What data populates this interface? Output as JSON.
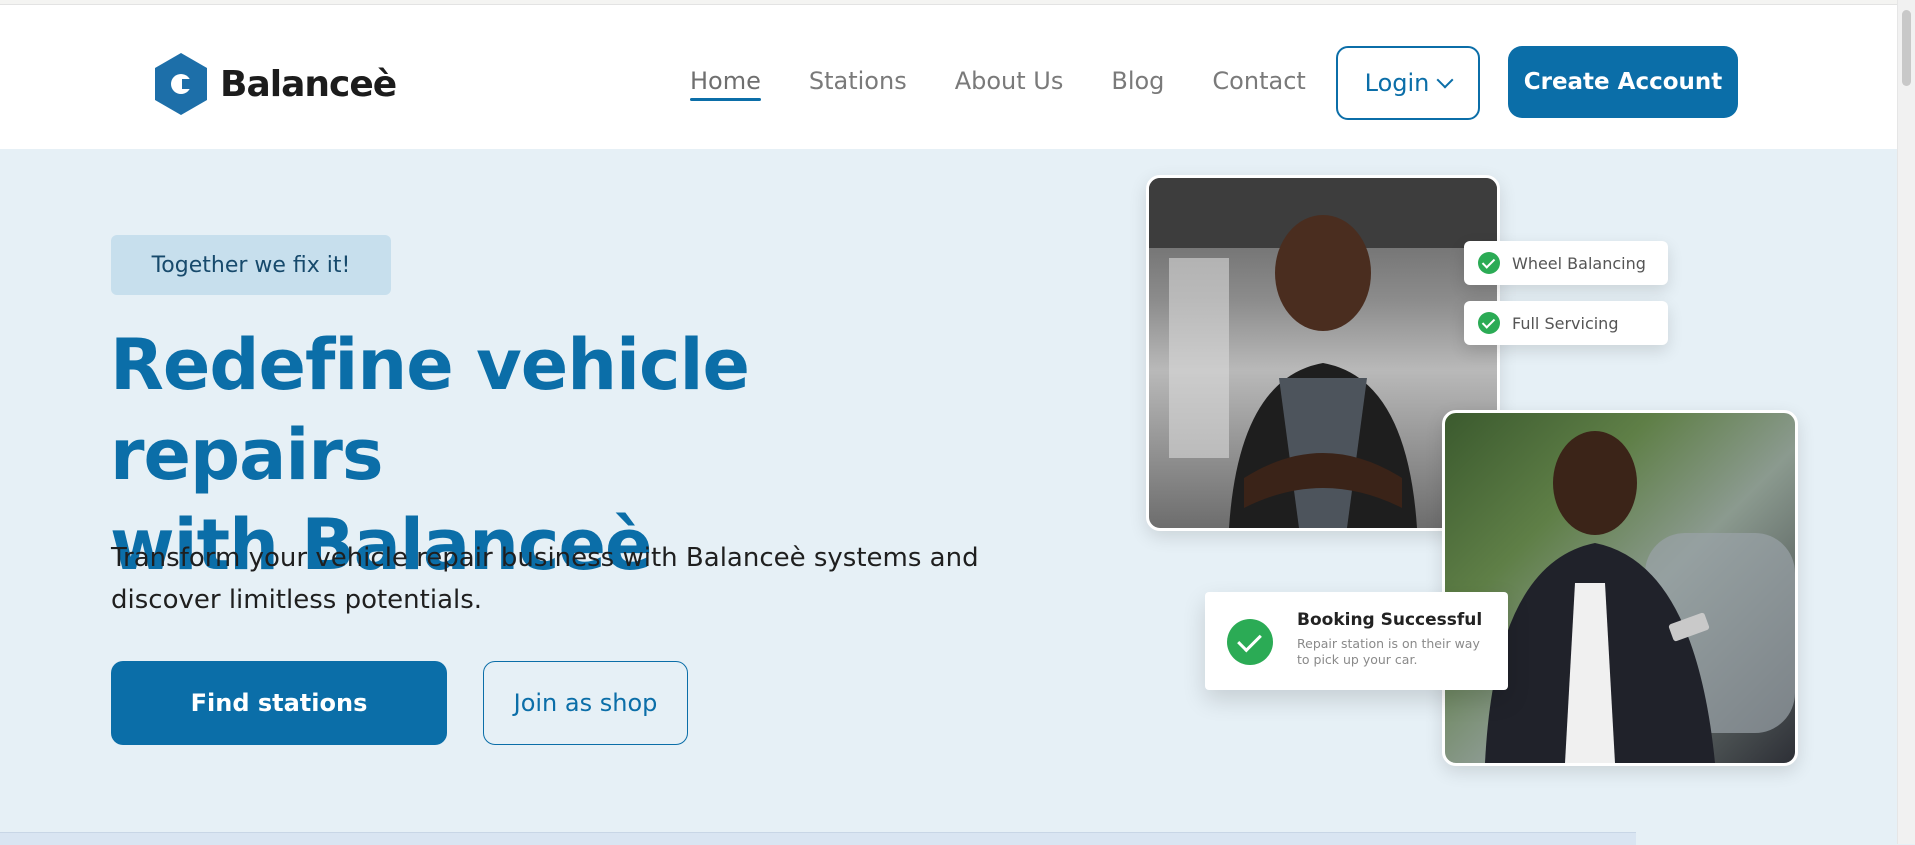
{
  "header": {
    "logo_text": "Balanceè",
    "nav": [
      "Home",
      "Stations",
      "About Us",
      "Blog",
      "Contact"
    ],
    "active_nav": "Home",
    "login_label": "Login",
    "create_account_label": "Create Account"
  },
  "hero": {
    "badge": "Together we fix it!",
    "headline_line1": "Redefine vehicle repairs",
    "headline_line2": "with Balanceè",
    "subtext_line1": "Transform your vehicle repair business with Balanceè systems and",
    "subtext_line2": "discover limitless potentials.",
    "find_stations_label": "Find stations",
    "join_label": "Join as shop"
  },
  "visual": {
    "pill_1": "Wheel Balancing",
    "pill_2": "Full Servicing",
    "booking_title": "Booking Successful",
    "booking_desc_line1": "Repair station is on their way",
    "booking_desc_line2": "to pick up your car."
  },
  "colors": {
    "brand": "#0b6ea8",
    "hero_bg": "#e6f0f6",
    "success": "#2bab55"
  },
  "icons": [
    "logo-hexagon-icon",
    "chevron-down-icon",
    "check-icon"
  ]
}
